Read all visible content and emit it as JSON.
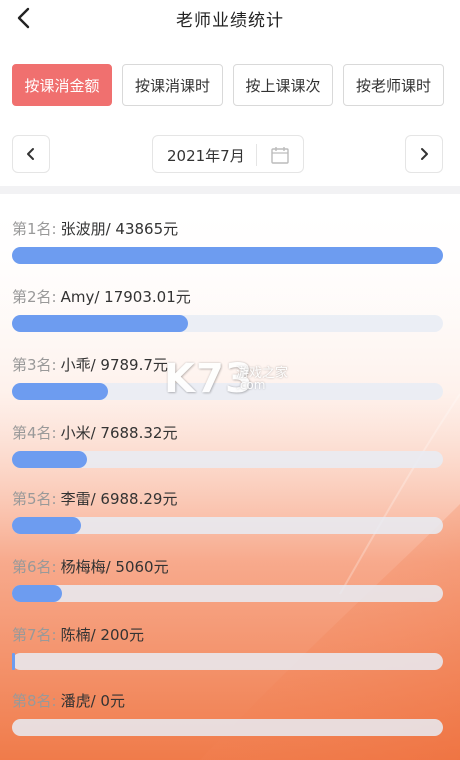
{
  "header": {
    "title": "老师业绩统计"
  },
  "tabs": [
    {
      "label": "按课消金额",
      "active": true
    },
    {
      "label": "按课消课时",
      "active": false
    },
    {
      "label": "按上课课次",
      "active": false
    },
    {
      "label": "按老师课时",
      "active": false
    }
  ],
  "date_nav": {
    "current": "2021年7月"
  },
  "ranking": [
    {
      "rank": "第1名:",
      "name": "张波朋/ 43865元",
      "ratio": 1.0
    },
    {
      "rank": "第2名:",
      "name": "Amy/ 17903.01元",
      "ratio": 0.408
    },
    {
      "rank": "第3名:",
      "name": "小乖/ 9789.7元",
      "ratio": 0.223
    },
    {
      "rank": "第4名:",
      "name": "小米/ 7688.32元",
      "ratio": 0.175
    },
    {
      "rank": "第5名:",
      "name": "李雷/ 6988.29元",
      "ratio": 0.159
    },
    {
      "rank": "第6名:",
      "name": "杨梅梅/ 5060元",
      "ratio": 0.115
    },
    {
      "rank": "第7名:",
      "name": "陈楠/ 200元",
      "ratio": 0.005
    },
    {
      "rank": "第8名:",
      "name": "潘虎/ 0元",
      "ratio": 0.0
    }
  ],
  "watermark": {
    "logo": "K73",
    "site": "游戏之家",
    "url": ".com"
  },
  "colors": {
    "accent": "#f0706f",
    "bar": "#6d9cf0",
    "track": "#e8ecf4",
    "gradient_bottom": "#f07b4a"
  },
  "icons": {
    "back": "chevron-left-icon",
    "prev": "chevron-left-icon",
    "next": "chevron-right-icon",
    "calendar": "calendar-icon"
  }
}
